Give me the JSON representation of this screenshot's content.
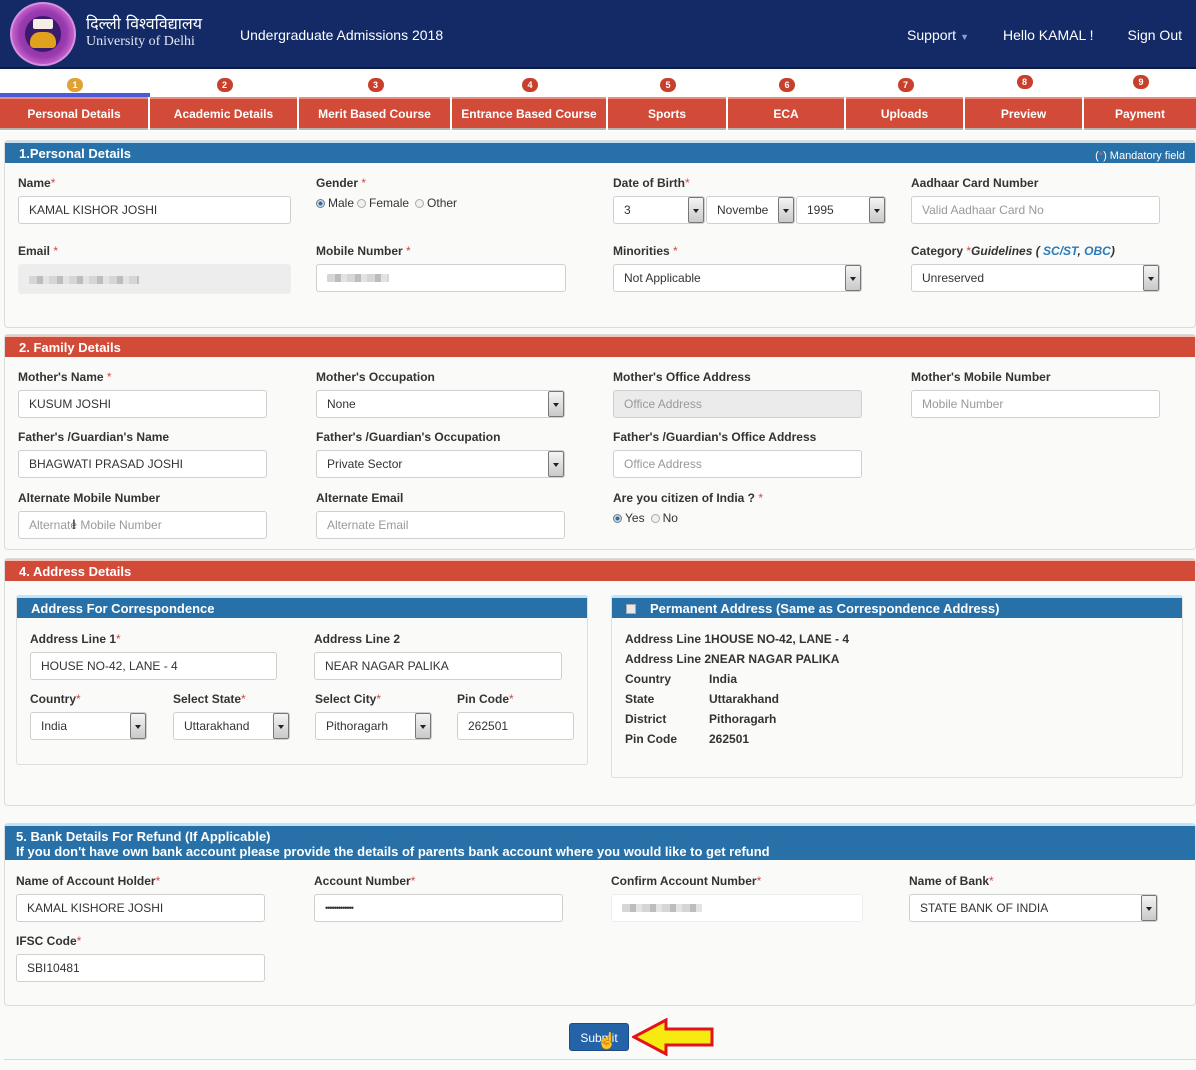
{
  "header": {
    "brand_hindi": "दिल्ली विश्वविद्यालय",
    "brand_english": "University of Delhi",
    "app_title": "Undergraduate Admissions 2018",
    "support": "Support",
    "greeting": "Hello KAMAL !",
    "sign_out": "Sign Out"
  },
  "steps": [
    {
      "num": "1",
      "label": "Personal Details",
      "active": true
    },
    {
      "num": "2",
      "label": "Academic Details"
    },
    {
      "num": "3",
      "label": "Merit Based Course"
    },
    {
      "num": "4",
      "label": "Entrance Based Course"
    },
    {
      "num": "5",
      "label": "Sports"
    },
    {
      "num": "6",
      "label": "ECA"
    },
    {
      "num": "7",
      "label": "Uploads"
    },
    {
      "num": "8",
      "label": "Preview"
    },
    {
      "num": "9",
      "label": "Payment"
    }
  ],
  "personal": {
    "title": "1.Personal Details",
    "mandatory_note_open": "(",
    "mandatory_star": "*",
    "mandatory_note": ") Mandatory field",
    "name_label": "Name",
    "name_value": "KAMAL KISHOR JOSHI",
    "gender_label": "Gender",
    "gender_options": [
      "Male",
      "Female",
      "Other"
    ],
    "gender_selected": "Male",
    "dob_label": "Date of Birth",
    "dob_day": "3",
    "dob_month": "Novembe",
    "dob_year": "1995",
    "aadhaar_label": "Aadhaar Card Number",
    "aadhaar_placeholder": "Valid Aadhaar Card No",
    "email_label": "Email",
    "mobile_label": "Mobile Number",
    "minorities_label": "Minorities",
    "minorities_value": "Not Applicable",
    "category_label": "Category",
    "guidelines_prefix": "Guidelines ( ",
    "guidelines_sc": "SC/ST",
    "guidelines_sep": ", ",
    "guidelines_obc": "OBC",
    "guidelines_suffix": ")",
    "category_value": "Unreserved",
    "required_mark": "*"
  },
  "family": {
    "title": "2. Family Details",
    "mother_name_label": "Mother's Name",
    "mother_name_value": "KUSUM JOSHI",
    "mother_occ_label": "Mother's Occupation",
    "mother_occ_value": "None",
    "mother_office_label": "Mother's Office Address",
    "mother_office_placeholder": "Office Address",
    "mother_mobile_label": "Mother's Mobile Number",
    "mother_mobile_placeholder": "Mobile Number",
    "father_name_label": "Father's /Guardian's Name",
    "father_name_value": "BHAGWATI PRASAD JOSHI",
    "father_occ_label": "Father's /Guardian's Occupation",
    "father_occ_value": "Private Sector",
    "father_office_label": "Father's /Guardian's Office Address",
    "father_office_placeholder": "Office Address",
    "alt_mobile_label": "Alternate Mobile Number",
    "alt_mobile_placeholder": "Alternate Mobile Number",
    "alt_email_label": "Alternate Email",
    "alt_email_placeholder": "Alternate Email",
    "citizen_label": "Are you citizen of India ?",
    "citizen_options": [
      "Yes",
      "No"
    ],
    "citizen_selected": "Yes"
  },
  "address": {
    "title": "4. Address Details",
    "corr_title": "Address For Correspondence",
    "line1_label": "Address Line 1",
    "line1_value": "HOUSE NO-42, LANE - 4",
    "line2_label": "Address Line 2",
    "line2_value": "NEAR NAGAR PALIKA",
    "country_label": "Country",
    "country_value": "India",
    "state_label": "Select State",
    "state_value": "Uttarakhand",
    "city_label": "Select City",
    "city_value": "Pithoragarh",
    "pin_label": "Pin Code",
    "pin_value": "262501",
    "perm_title": "Permanent Address (Same as Correspondence Address)",
    "perm_same_checked": true,
    "perm": {
      "line1_key": "Address Line 1",
      "line1": "HOUSE NO-42, LANE - 4",
      "line2_key": "Address Line 2",
      "line2": "NEAR NAGAR PALIKA",
      "country_key": "Country",
      "country": "India",
      "state_key": "State",
      "state": "Uttarakhand",
      "district_key": "District",
      "district": "Pithoragarh",
      "pin_key": "Pin Code",
      "pin": "262501"
    }
  },
  "bank": {
    "title_line1": "5. Bank Details For Refund (If Applicable)",
    "title_line2": "If you don't have own bank account please provide the details of parents bank account where you would like to get refund",
    "holder_label": "Name of Account Holder",
    "holder_value": "KAMAL KISHORE JOSHI",
    "acct_label": "Account Number",
    "acct_value": "•••••••••••••",
    "confirm_label": "Confirm Account Number",
    "bank_label": "Name of Bank",
    "bank_value": "STATE BANK OF INDIA",
    "ifsc_label": "IFSC Code",
    "ifsc_value": "SBI10481"
  },
  "submit_label": "Submit",
  "colors": {
    "header_bg": "#132a66",
    "tab_red": "#d24b39",
    "panel_blue": "#2770a8",
    "active_step": "#e0a237"
  }
}
